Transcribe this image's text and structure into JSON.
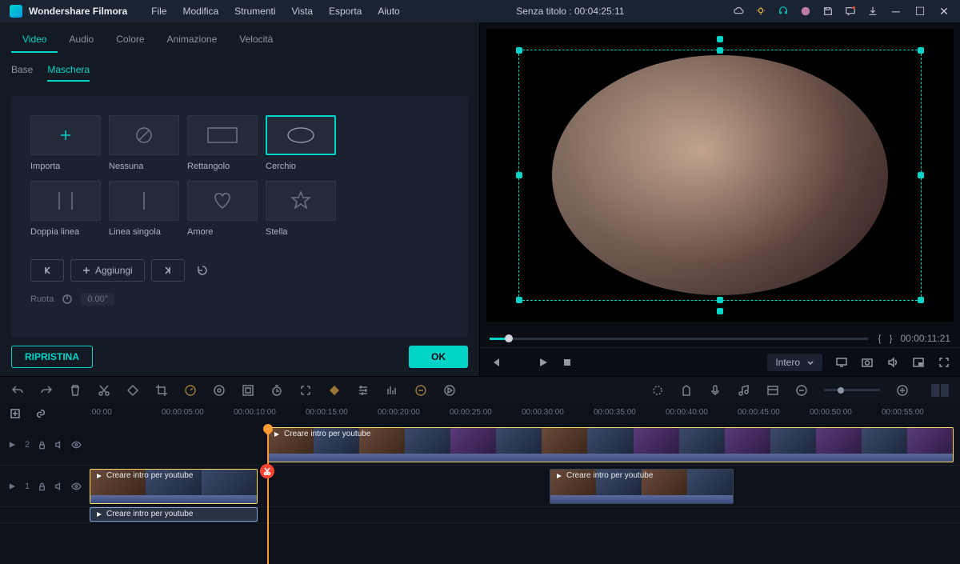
{
  "app": {
    "name": "Wondershare Filmora",
    "title": "Senza titolo : 00:04:25:11"
  },
  "menu": [
    "File",
    "Modifica",
    "Strumenti",
    "Vista",
    "Esporta",
    "Aiuto"
  ],
  "tabs": {
    "items": [
      "Video",
      "Audio",
      "Colore",
      "Animazione",
      "Velocità"
    ],
    "active": "Video"
  },
  "subtabs": {
    "items": [
      "Base",
      "Maschera"
    ],
    "active": "Maschera"
  },
  "masks": [
    {
      "id": "import",
      "label": "Importa"
    },
    {
      "id": "none",
      "label": "Nessuna"
    },
    {
      "id": "rect",
      "label": "Rettangolo"
    },
    {
      "id": "circle",
      "label": "Cerchio",
      "selected": true
    },
    {
      "id": "dline",
      "label": "Doppia linea"
    },
    {
      "id": "sline",
      "label": "Linea singola"
    },
    {
      "id": "heart",
      "label": "Amore"
    },
    {
      "id": "star",
      "label": "Stella"
    }
  ],
  "keyframe": {
    "add": "Aggiungi"
  },
  "rotate": {
    "label": "Ruota",
    "value": "0.00°"
  },
  "buttons": {
    "reset": "RIPRISTINA",
    "ok": "OK"
  },
  "preview": {
    "time": "00:00:11:21",
    "braces": {
      "l": "{",
      "r": "}"
    },
    "fit": "Intero"
  },
  "timeline": {
    "marks": [
      ":00:00",
      "00:00:05:00",
      "00:00:10:00",
      "00:00:15:00",
      "00:00:20:00",
      "00:00:25:00",
      "00:00:30:00",
      "00:00:35:00",
      "00:00:40:00",
      "00:00:45:00",
      "00:00:50:00",
      "00:00:55:00"
    ],
    "tracks": [
      {
        "id": 2,
        "label": "2"
      },
      {
        "id": 1,
        "label": "1"
      }
    ],
    "clips": {
      "a": "Creare intro per youtube",
      "b": "Creare intro per youtube",
      "c": "Creare intro per youtube",
      "d": "Creare intro per youtube"
    }
  }
}
